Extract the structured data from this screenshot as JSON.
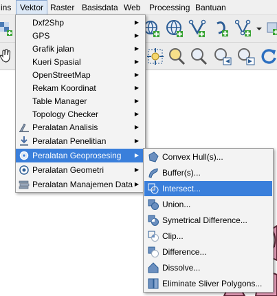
{
  "menubar": {
    "items": [
      "ins",
      "Vektor",
      "Raster",
      "Basisdata",
      "Web",
      "Processing",
      "Bantuan"
    ]
  },
  "vector_menu": {
    "items": [
      {
        "label": "Dxf2Shp",
        "submenu": true
      },
      {
        "label": "GPS",
        "submenu": true
      },
      {
        "label": "Grafik jalan",
        "submenu": true
      },
      {
        "label": "Kueri Spasial",
        "submenu": true
      },
      {
        "label": "OpenStreetMap",
        "submenu": true
      },
      {
        "label": "Rekam Koordinat",
        "submenu": true
      },
      {
        "label": "Table Manager",
        "submenu": true
      },
      {
        "label": "Topology Checker",
        "submenu": true
      },
      {
        "label": "Peralatan Analisis",
        "submenu": true
      },
      {
        "label": "Peralatan Penelitian",
        "submenu": true
      },
      {
        "label": "Peralatan Geoprosesing",
        "submenu": true
      },
      {
        "label": "Peralatan Geometri",
        "submenu": true
      },
      {
        "label": "Peralatan Manajemen Data",
        "submenu": true
      }
    ]
  },
  "geoprocessing_menu": {
    "items": [
      "Convex Hull(s)...",
      "Buffer(s)...",
      "Intersect...",
      "Union...",
      "Symetrical Difference...",
      "Clip...",
      "Difference...",
      "Dissolve...",
      "Eliminate Sliver Polygons..."
    ]
  },
  "colors": {
    "highlight": "#3a7fdb",
    "menu_bg": "#f3f3f3",
    "map_feature": "#f4a6c4"
  }
}
